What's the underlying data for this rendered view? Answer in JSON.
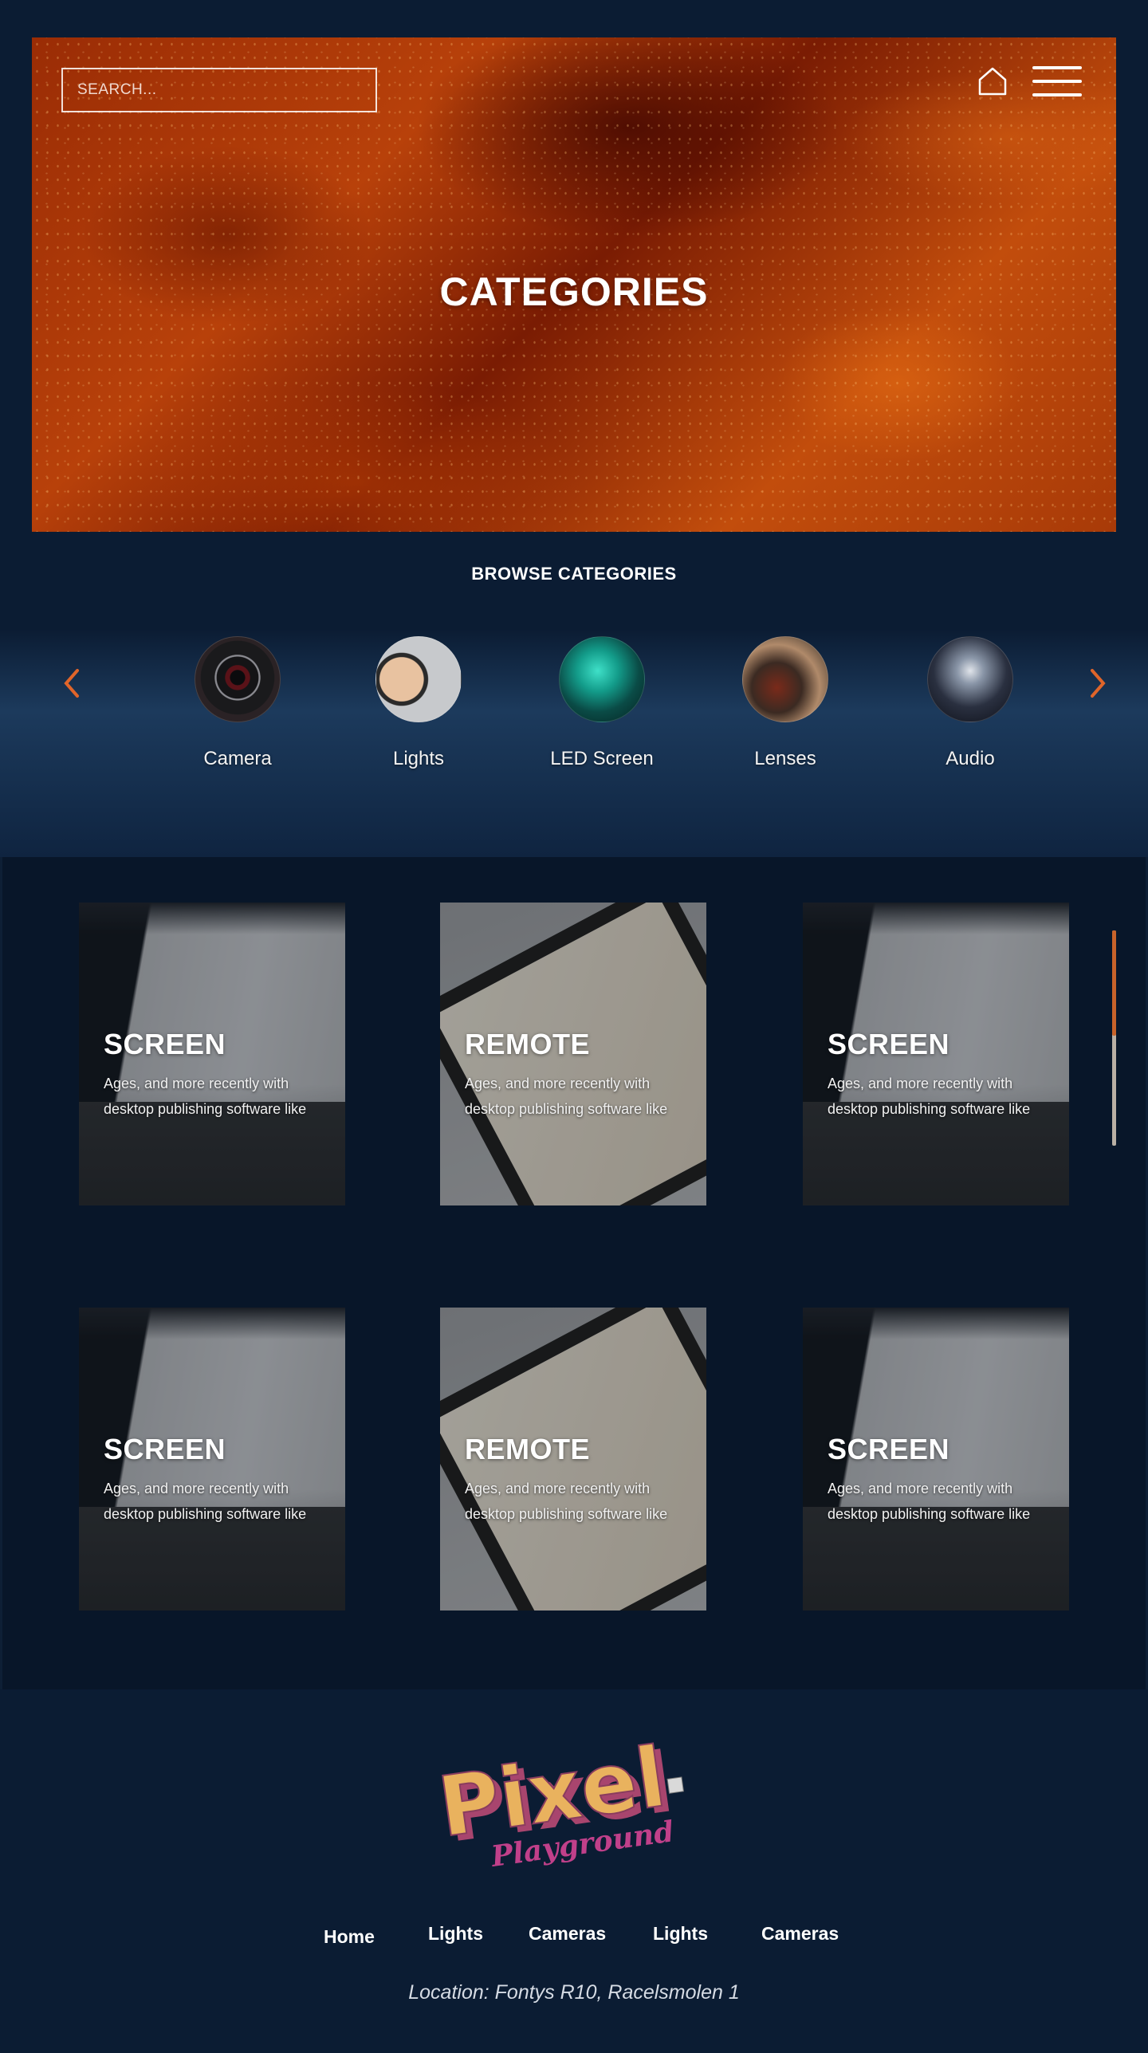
{
  "hero": {
    "search_placeholder": "SEARCH...",
    "title": "CATEGORIES",
    "home_icon": "home-icon",
    "menu_icon": "hamburger-menu-icon"
  },
  "browse": {
    "title": "BROWSE CATEGORIES",
    "prev_icon": "chevron-left-icon",
    "next_icon": "chevron-right-icon",
    "accent_color": "#e0652a",
    "categories": [
      {
        "label": "Camera"
      },
      {
        "label": "Lights"
      },
      {
        "label": "LED Screen"
      },
      {
        "label": "Lenses"
      },
      {
        "label": "Audio"
      }
    ]
  },
  "products": [
    {
      "title": "SCREEN",
      "description": "Ages, and more recently with desktop publishing software like"
    },
    {
      "title": "REMOTE",
      "description": "Ages, and more recently with desktop publishing software like"
    },
    {
      "title": "SCREEN",
      "description": "Ages, and more recently with desktop publishing software like"
    },
    {
      "title": "SCREEN",
      "description": "Ages, and more recently with desktop publishing software like"
    },
    {
      "title": "REMOTE",
      "description": "Ages, and more recently with desktop publishing software like"
    },
    {
      "title": "SCREEN",
      "description": "Ages, and more recently with desktop publishing software like"
    }
  ],
  "footer": {
    "logo_text": "Pixel",
    "logo_subtext": "Playground",
    "nav": [
      {
        "label": "Home"
      },
      {
        "label": "Lights"
      },
      {
        "label": "Cameras"
      },
      {
        "label": "Lights"
      },
      {
        "label": "Cameras"
      }
    ],
    "location": "Location: Fontys R10, Racelsmolen 1"
  },
  "colors": {
    "background": "#0b1c33",
    "grid_background": "#081629",
    "accent": "#e0652a",
    "logo_yellow": "#e9b25e",
    "logo_pink": "#c0408a"
  }
}
